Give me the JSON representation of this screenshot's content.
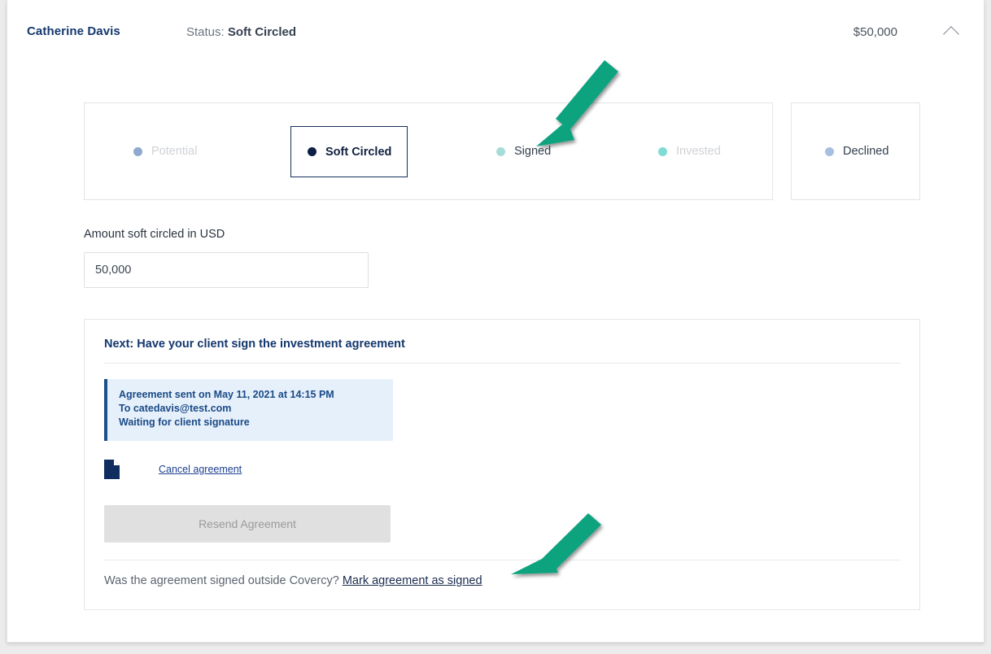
{
  "header": {
    "investor_name": "Catherine Davis",
    "status_label": "Status:",
    "status_value": "Soft Circled",
    "amount_total": "$50,000",
    "collapse_icon": "chevron-up-icon"
  },
  "stepper": {
    "stages": [
      {
        "label": "Potential",
        "dot_color": "#8fa9d0",
        "state": "past"
      },
      {
        "label": "Soft Circled",
        "dot_color": "#0d1f45",
        "state": "current"
      },
      {
        "label": "Signed",
        "dot_color": "#a8dcd9",
        "state": "next"
      },
      {
        "label": "Invested",
        "dot_color": "#7fdbd4",
        "state": "future"
      }
    ],
    "declined": {
      "label": "Declined",
      "dot_color": "#a9bfe0",
      "state": "available"
    }
  },
  "amount": {
    "label": "Amount soft circled in USD",
    "value": "50,000",
    "placeholder": "Amount"
  },
  "next_panel": {
    "title": "Next: Have your client sign the investment agreement",
    "info_lines": [
      "Agreement sent on May 11, 2021 at 14:15 PM",
      "To catedavis@test.com",
      "Waiting for client signature"
    ],
    "document_icon": "document-icon",
    "cancel_link": "Cancel agreement",
    "resend_button": "Resend Agreement",
    "outside_question": "Was the agreement signed outside Covercy?",
    "mark_signed_link": "Mark agreement as signed"
  },
  "annotations": {
    "arrow_color": "#10a37f",
    "arrows": [
      {
        "name": "arrow-to-signed",
        "points_to": "Signed"
      },
      {
        "name": "arrow-to-mark-agreement-as-signed",
        "points_to": "Mark agreement as signed"
      }
    ]
  }
}
